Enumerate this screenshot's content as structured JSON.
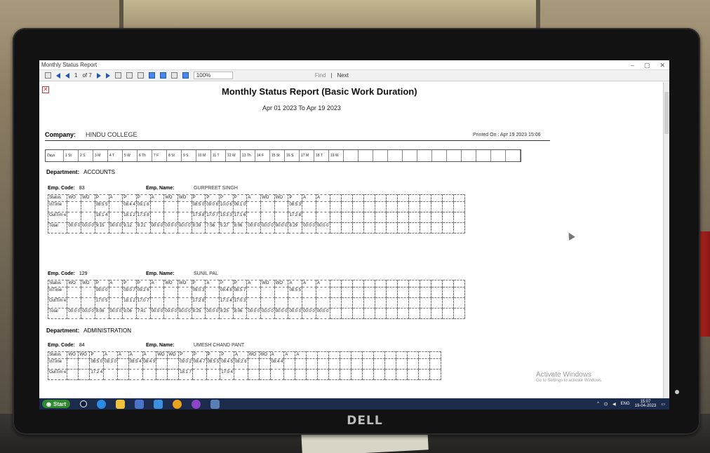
{
  "window": {
    "title": "Monthly Status Report",
    "controls": [
      "–",
      "▢",
      "✕"
    ]
  },
  "toolbar": {
    "page_current": "1",
    "page_of": "of 7",
    "zoom": "100%",
    "find": "Find",
    "separator": "|",
    "next": "Next"
  },
  "report": {
    "title": "Monthly Status Report (Basic Work Duration)",
    "date_range": "Apr 01 2023  To  Apr 19 2023",
    "company_label": "Company:",
    "company_name": "HINDU COLLEGE",
    "printed_on": "Printed On : Apr 19 2023 15:06",
    "days_label": "Days",
    "days": [
      "1 St",
      "2 S",
      "3 M",
      "4 T",
      "5 W",
      "6 Th",
      "7 F",
      "8 St",
      "9 S",
      "10 M",
      "11 T",
      "12 W",
      "13 Th",
      "14 F",
      "15 St",
      "16 S",
      "17 M",
      "18 T",
      "19 W"
    ],
    "blank_day_cells": 12,
    "departments": [
      {
        "label": "Department:",
        "name": "ACCOUNTS",
        "employees": [
          {
            "code_label": "Emp. Code:",
            "code": "83",
            "name_label": "Emp. Name:",
            "name": "GURPREET SINGH",
            "rows": [
              {
                "label": "Status",
                "cells": [
                  "WO",
                  "WO",
                  "P",
                  "A",
                  "P",
                  "P",
                  "A",
                  "WO",
                  "WO",
                  "P",
                  "P",
                  "P",
                  "P",
                  "A",
                  "WO",
                  "WO",
                  "P",
                  "A",
                  "A"
                ]
              },
              {
                "label": "InTime",
                "cells": [
                  "",
                  "",
                  "08:5 5",
                  "",
                  "08:4 4",
                  "09:1 6",
                  "",
                  "",
                  "",
                  "08:5 0",
                  "09:0 8",
                  "10:0 6",
                  "09:1 0",
                  "",
                  "",
                  "",
                  "08:5 3",
                  "",
                  ""
                ]
              },
              {
                "label": "OutTim e",
                "cells": [
                  "",
                  "",
                  "18:1 4",
                  "",
                  "18:1 2",
                  "17:3 8",
                  "",
                  "",
                  "",
                  "17:3 8",
                  "17:0 7",
                  "15:3 3",
                  "17:1 6",
                  "",
                  "",
                  "",
                  "17:2 8",
                  "",
                  ""
                ]
              },
              {
                "label": "Total",
                "cells": [
                  "00:0 0",
                  "00:0 0",
                  "9:15",
                  "00:0 0",
                  "9:12",
                  "8:21",
                  "00:0 0",
                  "00:0 0",
                  "00:0 0",
                  "8:39",
                  "7:56",
                  "5:27",
                  "8:06",
                  "00:0 0",
                  "00:0 0",
                  "00:0 0",
                  "8:29",
                  "00:0 0",
                  "00:0 0"
                ]
              }
            ]
          },
          {
            "code_label": "Emp. Code:",
            "code": "129",
            "name_label": "Emp. Name:",
            "name": "SUNIL PAL",
            "rows": [
              {
                "label": "Status",
                "cells": [
                  "WO",
                  "WO",
                  "P",
                  "A",
                  "P",
                  "P",
                  "A",
                  "WO",
                  "WO",
                  "P",
                  "A",
                  "P",
                  "P",
                  "A",
                  "WO",
                  "WO",
                  "A",
                  "A",
                  "A"
                ]
              },
              {
                "label": "InTime",
                "cells": [
                  "",
                  "",
                  "09:0 0",
                  "",
                  "09:0 7",
                  "09:2 6",
                  "",
                  "",
                  "",
                  "09:0 3",
                  "",
                  "08:4 8",
                  "08:5 7",
                  "",
                  "",
                  "",
                  "08:5 5",
                  "",
                  ""
                ]
              },
              {
                "label": "OutTim e",
                "cells": [
                  "",
                  "",
                  "17:0 5",
                  "",
                  "18:1 2",
                  "17:0 7",
                  "",
                  "",
                  "",
                  "17:2 8",
                  "",
                  "17:2 4",
                  "17:0 3",
                  "",
                  "",
                  "",
                  "",
                  "",
                  ""
                ]
              },
              {
                "label": "Total",
                "cells": [
                  "00:0 0",
                  "00:0 0",
                  "8:06",
                  "00:0 0",
                  "9:06",
                  "7:41",
                  "00:0 0",
                  "00:0 0",
                  "00:0 0",
                  "8:25",
                  "00:0 0",
                  "8:25",
                  "8:06",
                  "00:0 0",
                  "00:0 0",
                  "00:0 0",
                  "00:0 0",
                  "00:0 0",
                  "00:0 0"
                ]
              }
            ]
          }
        ]
      },
      {
        "label": "Department:",
        "name": "ADMINISTRATION",
        "employees": [
          {
            "code_label": "Emp. Code:",
            "code": "84",
            "name_label": "Emp. Name:",
            "name": "UMESH CHAND PANT",
            "rows": [
              {
                "label": "Status",
                "cells": [
                  "WO",
                  "WO",
                  "P",
                  "A",
                  "A",
                  "A",
                  "A",
                  "WO",
                  "WO",
                  "P",
                  "P",
                  "P",
                  "P",
                  "A",
                  "WO",
                  "WO",
                  "A",
                  "A",
                  "A"
                ]
              },
              {
                "label": "InTime",
                "cells": [
                  "",
                  "",
                  "08:5 0",
                  "08:3 0",
                  "",
                  "08:5 4",
                  "08:4 9",
                  "",
                  "",
                  "09:0 2",
                  "08:4 7",
                  "08:5 5",
                  "08:4 5",
                  "08:2 8",
                  "",
                  "",
                  "08:4 4",
                  "",
                  ""
                ]
              },
              {
                "label": "OutTim e",
                "cells": [
                  "",
                  "",
                  "17:2 4",
                  "",
                  "",
                  "",
                  "",
                  "",
                  "",
                  "18:1 7",
                  "",
                  "",
                  "17:0 4",
                  "",
                  "",
                  "",
                  "",
                  "",
                  ""
                ]
              }
            ]
          }
        ]
      }
    ]
  },
  "watermark": {
    "title": "Activate Windows",
    "subtitle": "Go to Settings to activate Windows."
  },
  "taskbar": {
    "start": "Start",
    "lang": "ENG",
    "time": "15:07",
    "date": "19-04-2023"
  },
  "monitor": {
    "brand": "DELL"
  },
  "colors": {
    "taskbar": "#1c2a4c",
    "start_button": "#2e8a2e",
    "bezel": "#121213"
  }
}
